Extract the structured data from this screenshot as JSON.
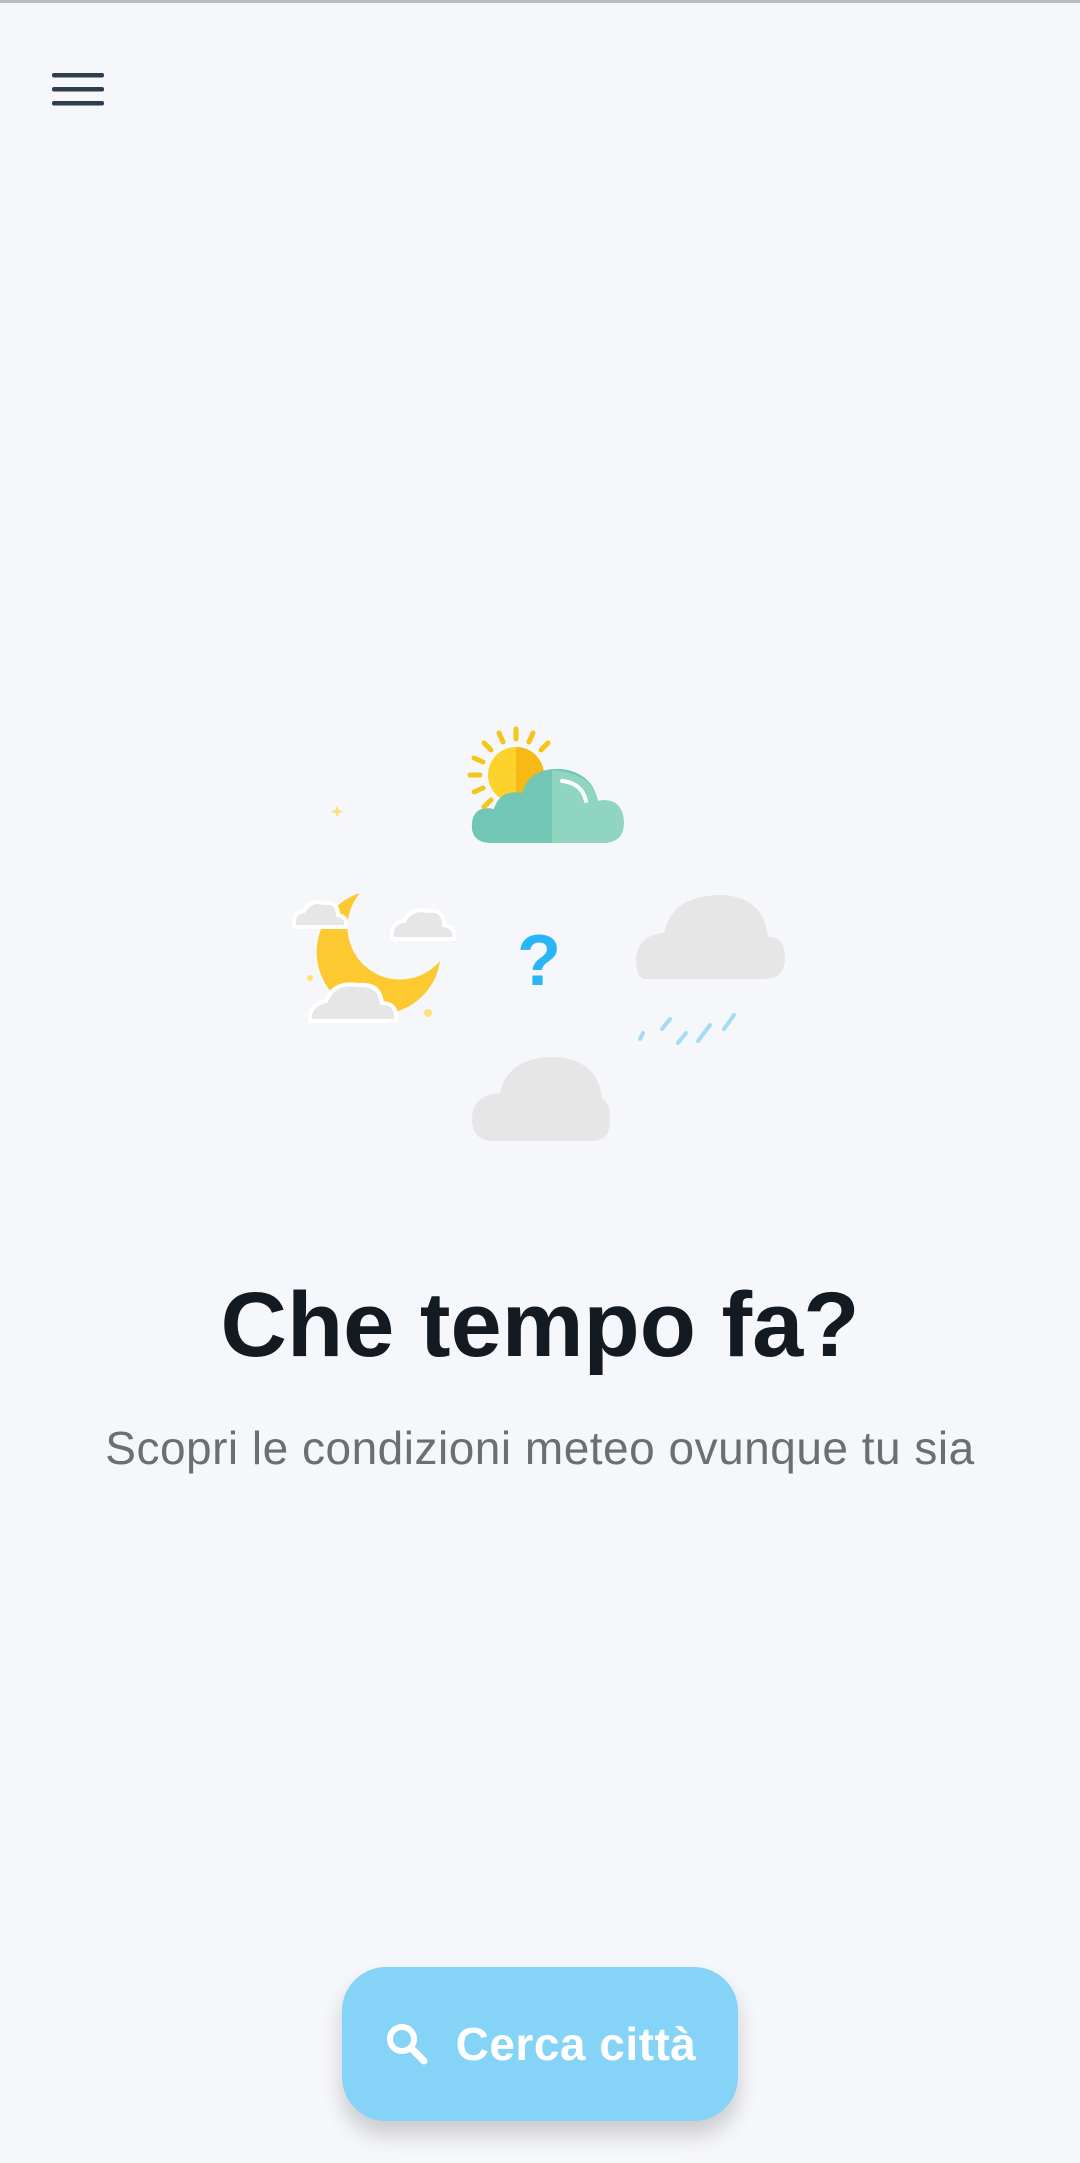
{
  "app": {
    "menu_icon": "hamburger-menu-icon"
  },
  "main": {
    "title": "Che tempo fa?",
    "subtitle": "Scopri le condizioni meteo ovunque tu sia",
    "illustration": {
      "question_mark": "?",
      "icons": [
        "sun-behind-cloud-icon",
        "moon-cloud-icon",
        "rain-cloud-icon",
        "cloud-icon"
      ]
    }
  },
  "search": {
    "label": "Cerca città",
    "icon": "search-icon",
    "color": "#86d3f8"
  },
  "colors": {
    "background": "#f6f7fb",
    "title": "#141a22",
    "subtitle": "#6b6e73",
    "accent": "#29b6f6"
  }
}
